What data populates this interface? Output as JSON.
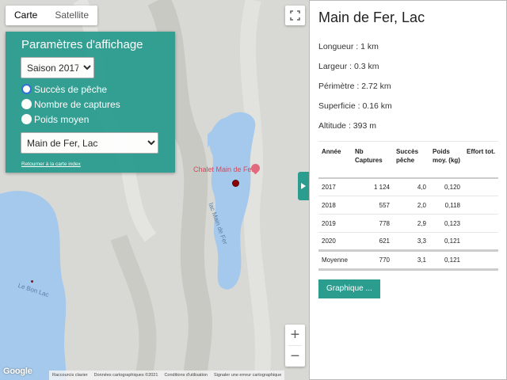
{
  "map": {
    "tabs": [
      {
        "label": "Carte",
        "active": true
      },
      {
        "label": "Satellite",
        "active": false
      }
    ],
    "zoom_in": "+",
    "zoom_out": "−",
    "labels": {
      "poi": "Chalet Main de Fer",
      "lake_main": "lac Main de Fer",
      "lake_other": "Le Bon Lac"
    },
    "logo": "Google",
    "attribution": [
      "Raccourcis clavier",
      "Données cartographiques ©2021",
      "Conditions d'utilisation",
      "Signaler une erreur cartographique"
    ],
    "colors": {
      "water": "#a4c9ec",
      "terrain": "#d7d7d3",
      "accent": "#2a9d8f"
    }
  },
  "params": {
    "title": "Paramètres d'affichage",
    "season_selected": "Saison 2017",
    "radios": [
      {
        "label": "Succès de pêche",
        "checked": true
      },
      {
        "label": "Nombre de captures",
        "checked": false
      },
      {
        "label": "Poids moyen",
        "checked": false
      }
    ],
    "lake_selected": "Main de Fer, Lac",
    "return_link": "Retourner à la carte index"
  },
  "panel": {
    "title": "Main de Fer, Lac",
    "stats": [
      "Longueur : 1 km",
      "Largeur : 0.3 km",
      "Périmètre : 2.72 km",
      "Superficie : 0.16 km",
      "Altitude : 393 m"
    ],
    "table": {
      "headers": [
        "Année",
        "Nb Captures",
        "Succès pêche",
        "Poids moy. (kg)",
        "Effort tot."
      ],
      "rows": [
        [
          "2017",
          "1 124",
          "4,0",
          "0,120",
          ""
        ],
        [
          "2018",
          "557",
          "2,0",
          "0,118",
          ""
        ],
        [
          "2019",
          "778",
          "2,9",
          "0,123",
          ""
        ],
        [
          "2020",
          "621",
          "3,3",
          "0,121",
          ""
        ]
      ],
      "average": [
        "Moyenne",
        "770",
        "3,1",
        "0,121",
        ""
      ]
    },
    "graph_button": "Graphique ..."
  }
}
